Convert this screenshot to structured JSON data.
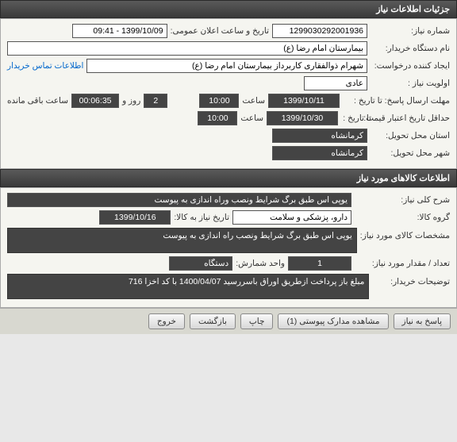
{
  "section1": {
    "title": "جزئیات اطلاعات نیاز"
  },
  "need": {
    "number_label": "شماره نیاز:",
    "number": "1299030292001936",
    "announce_label": "تاریخ و ساعت اعلان عمومی:",
    "announce": "1399/10/09 - 09:41",
    "buyer_label": "نام دستگاه خریدار:",
    "buyer": "بیمارستان امام رضا (ع)",
    "requester_label": "ایجاد کننده درخواست:",
    "requester": "شهرام ذوالفقاری کاربرداز بیمارستان امام رضا (ع)",
    "contact_link": "اطلاعات تماس خریدار",
    "priority_label": "اولویت نیاز :",
    "priority": "عادی",
    "deadline_label": "مهلت ارسال پاسخ:",
    "to_date_label": "تا تاریخ :",
    "deadline_date": "1399/10/11",
    "time_label": "ساعت",
    "deadline_time": "10:00",
    "days": "2",
    "days_label": "روز و",
    "countdown": "00:06:35",
    "remain_label": "ساعت باقی مانده",
    "credit_label": "حداقل تاریخ اعتبار قیمت:",
    "credit_date": "1399/10/30",
    "credit_time": "10:00",
    "province_label": "استان محل تحویل:",
    "province": "کرمانشاه",
    "city_label": "شهر محل تحویل:",
    "city": "کرمانشاه"
  },
  "section2": {
    "title": "اطلاعات کالاهای مورد نیاز"
  },
  "goods": {
    "desc_label": "شرح کلی نیاز:",
    "desc": "یوپی اس طبق برگ شرایط ونصب وراه اندازی به پیوست",
    "group_label": "گروه کالا:",
    "group": "دارو، پزشکی و سلامت",
    "need_date_label": "تاریخ نیاز به کالا:",
    "need_date": "1399/10/16",
    "specs_label": "مشخصات کالای مورد نیاز:",
    "specs": "یوپی اس طبق برگ شرایط ونصب راه اندازی به پیوست",
    "qty_label": "تعداد / مقدار مورد نیاز:",
    "qty": "1",
    "unit_label": "واحد شمارش:",
    "unit": "دستگاه",
    "buyer_notes_label": "توضیحات خریدار:",
    "buyer_notes": "مبلغ باز پرداخت ازطریق اوراق باسررسید 1400/04/07 با کد اخزا 716"
  },
  "buttons": {
    "respond": "پاسخ به نیاز",
    "attachments": "مشاهده مدارک پیوستی (1)",
    "print": "چاپ",
    "back": "بازگشت",
    "exit": "خروج"
  }
}
